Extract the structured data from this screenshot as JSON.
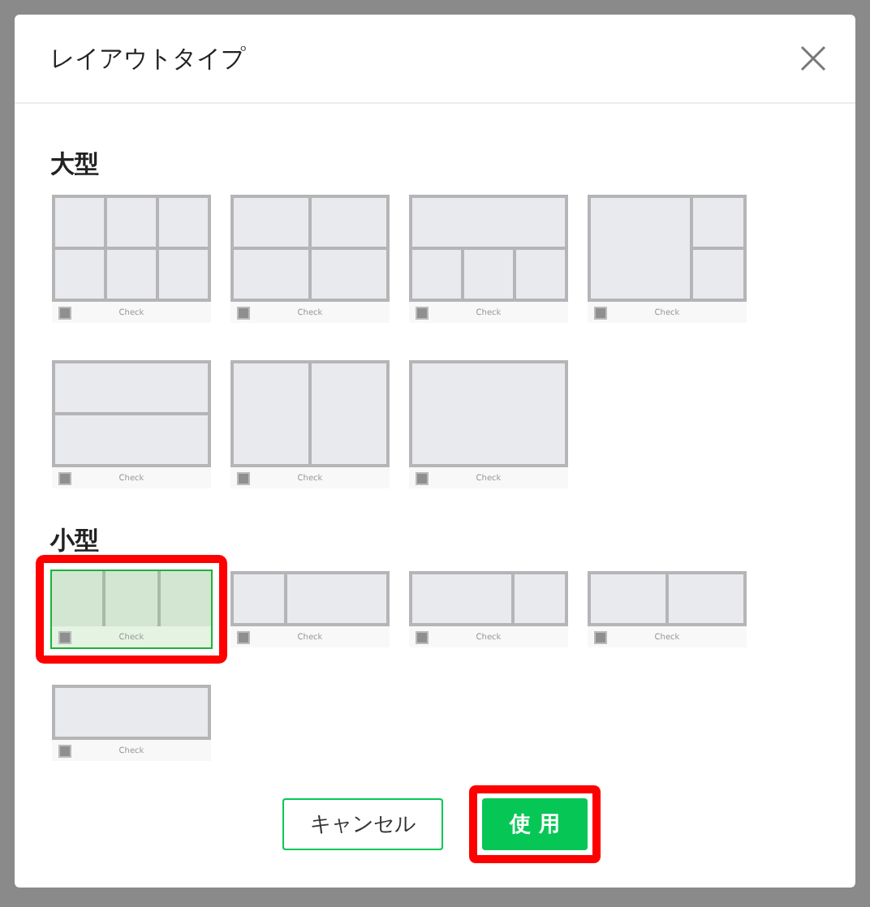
{
  "dialog": {
    "title": "レイアウトタイプ"
  },
  "sections": [
    {
      "title": "大型",
      "layouts": [
        {
          "kind": "grid-3x2",
          "caption": "Check",
          "selected": false,
          "highlighted": false
        },
        {
          "kind": "grid-2x2",
          "caption": "Check",
          "selected": false,
          "highlighted": false
        },
        {
          "kind": "top-1-bottom-3",
          "caption": "Check",
          "selected": false,
          "highlighted": false
        },
        {
          "kind": "main-left-2-right",
          "caption": "Check",
          "selected": false,
          "highlighted": false
        },
        {
          "kind": "rows-2",
          "caption": "Check",
          "selected": false,
          "highlighted": false
        },
        {
          "kind": "cols-2",
          "caption": "Check",
          "selected": false,
          "highlighted": false
        },
        {
          "kind": "single",
          "caption": "Check",
          "selected": false,
          "highlighted": false
        }
      ]
    },
    {
      "title": "小型",
      "layouts": [
        {
          "kind": "cols-3",
          "caption": "Check",
          "selected": true,
          "highlighted": true
        },
        {
          "kind": "cols-narrow-wide",
          "caption": "Check",
          "selected": false,
          "highlighted": false
        },
        {
          "kind": "cols-wide-narrow",
          "caption": "Check",
          "selected": false,
          "highlighted": false
        },
        {
          "kind": "cols-2",
          "caption": "Check",
          "selected": false,
          "highlighted": false
        },
        {
          "kind": "single",
          "caption": "Check",
          "selected": false,
          "highlighted": false
        }
      ]
    }
  ],
  "buttons": [
    {
      "kind": "secondary",
      "label": "キャンセル",
      "highlighted": false
    },
    {
      "kind": "primary",
      "label": "使 用",
      "highlighted": true
    }
  ]
}
